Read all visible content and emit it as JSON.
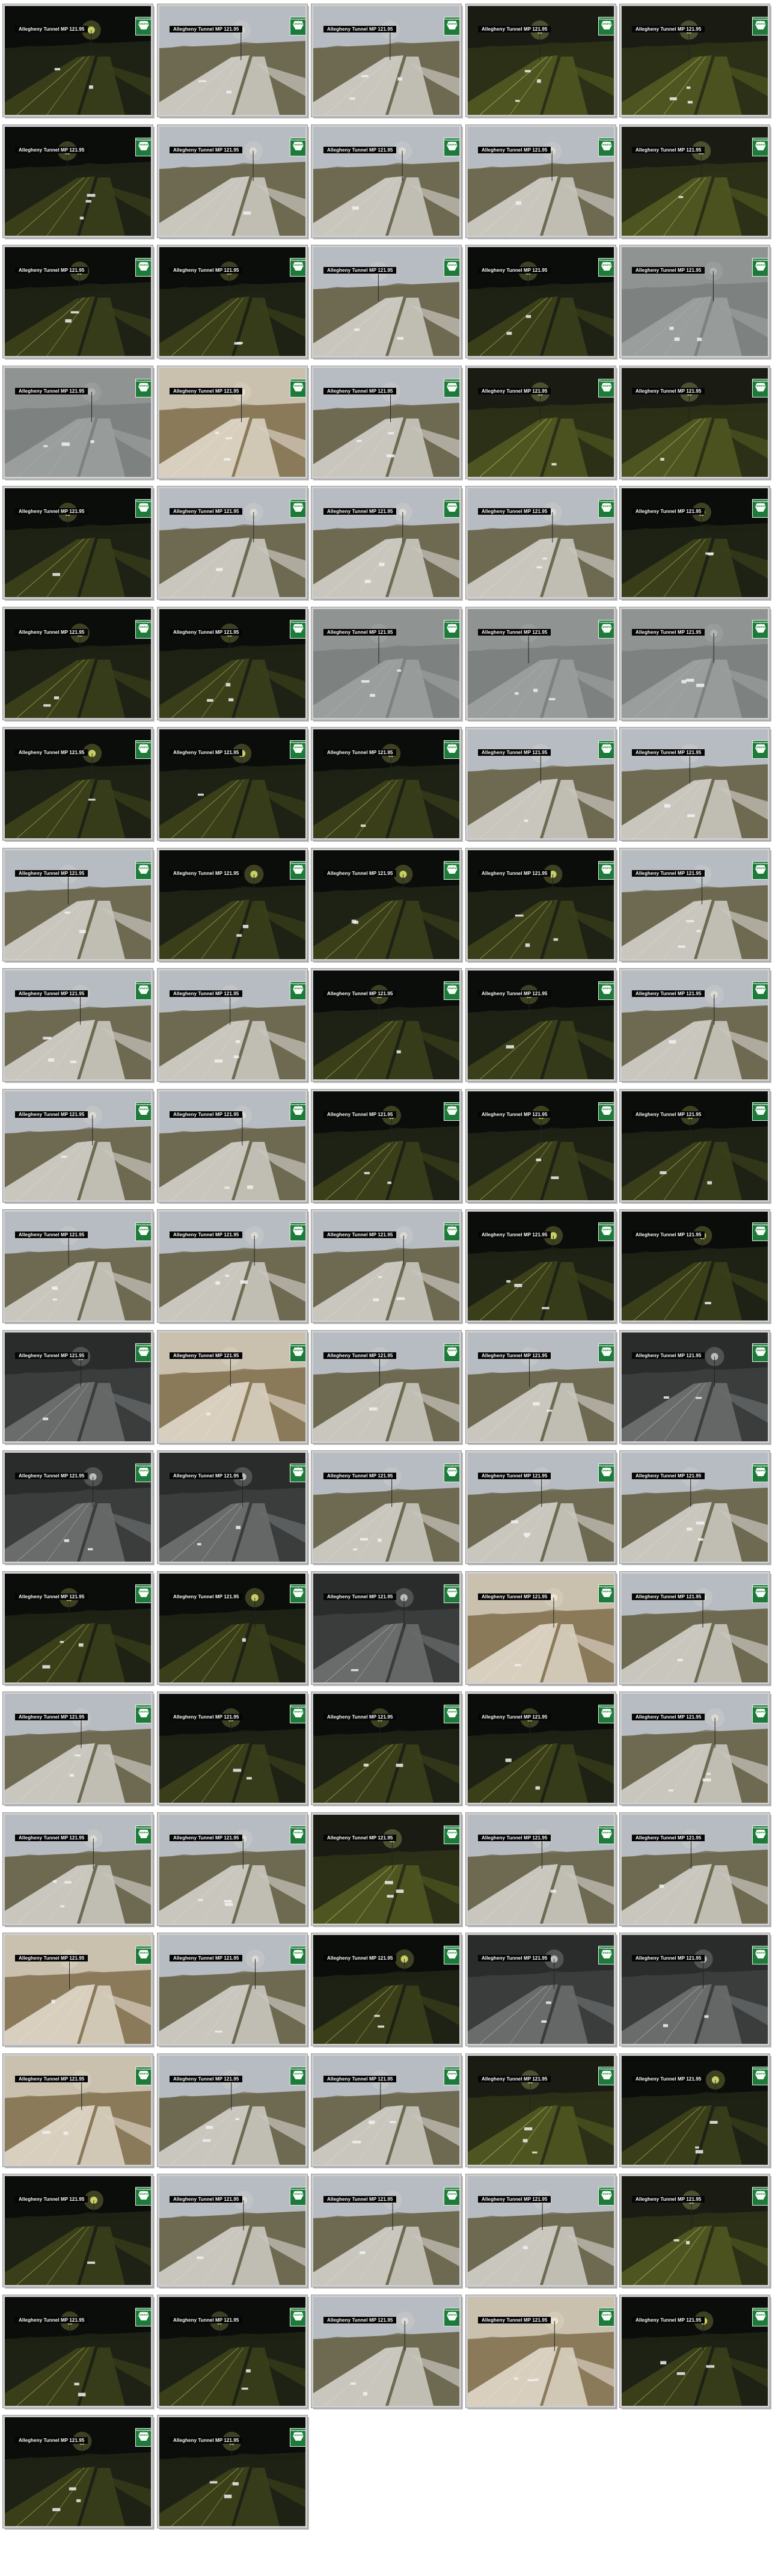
{
  "camera_caption": "Allegheny Tunnel MP 121.95",
  "logo_text": {
    "top": "Pennsylvania",
    "main": "TURNPIKE"
  },
  "columns": 5,
  "thumbnails": [
    "night",
    "day",
    "day",
    "dusk",
    "dusk",
    "night",
    "day",
    "day",
    "day",
    "dusk",
    "night",
    "night",
    "day",
    "night",
    "fog",
    "fog",
    "sun",
    "day",
    "dusk",
    "dusk",
    "night",
    "day",
    "day",
    "day",
    "night",
    "night",
    "night",
    "fog",
    "fog",
    "fog",
    "night",
    "night",
    "night",
    "day",
    "day",
    "day",
    "night",
    "night",
    "night",
    "day",
    "day",
    "day",
    "night",
    "night",
    "day",
    "day",
    "day",
    "night",
    "night",
    "night",
    "day",
    "day",
    "day",
    "night",
    "night",
    "gray",
    "sun",
    "day",
    "day",
    "gray",
    "gray",
    "gray",
    "day",
    "day",
    "day",
    "night",
    "night",
    "gray",
    "sun",
    "day",
    "day",
    "night",
    "night",
    "night",
    "day",
    "day",
    "day",
    "dusk",
    "day",
    "day",
    "sun",
    "day",
    "night",
    "gray",
    "gray",
    "sun",
    "day",
    "day",
    "dusk",
    "night",
    "night",
    "day",
    "day",
    "day",
    "dusk",
    "night",
    "night",
    "day",
    "sun",
    "night",
    "night",
    "night"
  ],
  "palettes": {
    "night": {
      "sky": "#0a0d0a",
      "land": "#1d2214",
      "road": "#3a3f1a",
      "glow": "#d9e06a"
    },
    "dusk": {
      "sky": "#1a1c14",
      "land": "#2b3016",
      "road": "#4f5520",
      "glow": "#e4ee82"
    },
    "day": {
      "sky": "#b7bcc2",
      "land": "#6e6a52",
      "road": "#c9c6be",
      "glow": "#dedcd4"
    },
    "sun": {
      "sky": "#c9c0ae",
      "land": "#8a7a5a",
      "road": "#d8cfbf",
      "glow": "#efe6d2"
    },
    "fog": {
      "sky": "#8f9392",
      "land": "#7d8180",
      "road": "#9a9e9c",
      "glow": "#b3b6b4"
    },
    "gray": {
      "sky": "#2a2c2c",
      "land": "#3b3d3d",
      "road": "#6a6c6c",
      "glow": "#c7c9c9"
    }
  }
}
